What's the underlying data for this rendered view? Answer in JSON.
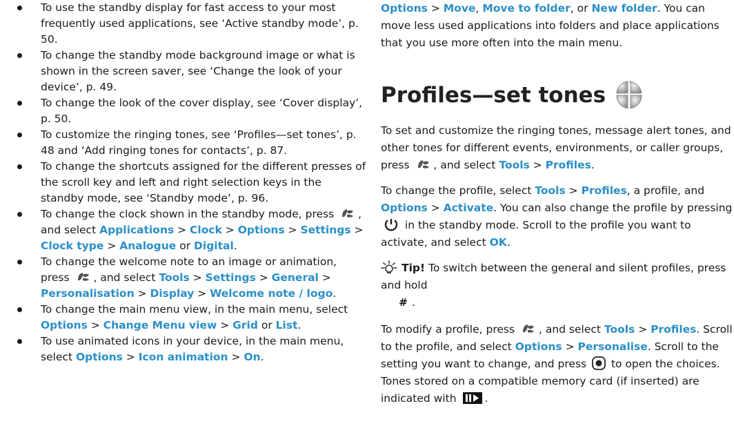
{
  "left": {
    "bullets": [
      {
        "parts": [
          {
            "t": "To use the standby display for fast access to your most frequently used applications, see ‘Active standby mode’, p. 50."
          }
        ]
      },
      {
        "parts": [
          {
            "t": "To change the standby mode background image or what is shown in the screen saver, see ‘Change the look of your device’, p. 49."
          }
        ]
      },
      {
        "parts": [
          {
            "t": "To change the look of the cover display, see ‘Cover display’, p. 50."
          }
        ]
      },
      {
        "parts": [
          {
            "t": "To customize the ringing tones, see ‘Profiles—set tones’, p. 48 and ‘Add ringing tones for contacts’, p. 87."
          }
        ]
      },
      {
        "parts": [
          {
            "t": "To change the shortcuts assigned for the different presses of the scroll key and left and right selection keys in the standby mode, see ‘Standby mode’, p. 96."
          }
        ]
      },
      {
        "parts": [
          {
            "t": "To change the clock shown in the standby mode, press "
          },
          {
            "icon": "menu-key-icon"
          },
          {
            "t": ", and select "
          },
          {
            "k": "Applications"
          },
          {
            "t": " > "
          },
          {
            "k": "Clock"
          },
          {
            "t": " > "
          },
          {
            "k": "Options"
          },
          {
            "t": " > "
          },
          {
            "k": "Settings"
          },
          {
            "t": " > "
          },
          {
            "k": "Clock type"
          },
          {
            "t": " > "
          },
          {
            "k": "Analogue"
          },
          {
            "t": " or "
          },
          {
            "k": "Digital"
          },
          {
            "t": "."
          }
        ]
      },
      {
        "parts": [
          {
            "t": "To change the welcome note to an image or animation, press "
          },
          {
            "icon": "menu-key-icon"
          },
          {
            "t": ", and select "
          },
          {
            "k": "Tools"
          },
          {
            "t": " > "
          },
          {
            "k": "Settings"
          },
          {
            "t": " > "
          },
          {
            "k": "General"
          },
          {
            "t": " > "
          },
          {
            "k": "Personalisation"
          },
          {
            "t": " > "
          },
          {
            "k": "Display"
          },
          {
            "t": " > "
          },
          {
            "k": "Welcome note / logo"
          },
          {
            "t": "."
          }
        ]
      },
      {
        "parts": [
          {
            "t": "To change the main menu view, in the main menu, select "
          },
          {
            "k": "Options"
          },
          {
            "t": " > "
          },
          {
            "k": "Change Menu view"
          },
          {
            "t": " > "
          },
          {
            "k": "Grid"
          },
          {
            "t": " or "
          },
          {
            "k": "List"
          },
          {
            "t": "."
          }
        ]
      },
      {
        "parts": [
          {
            "t": "To use animated icons in your device, in the main menu, select "
          },
          {
            "k": "Options"
          },
          {
            "t": " > "
          },
          {
            "k": "Icon animation"
          },
          {
            "t": " > "
          },
          {
            "k": "On"
          },
          {
            "t": "."
          }
        ]
      }
    ]
  },
  "right": {
    "intro": [
      {
        "k": "Options"
      },
      {
        "t": " > "
      },
      {
        "k": "Move"
      },
      {
        "t": ", "
      },
      {
        "k": "Move to folder"
      },
      {
        "t": ", or "
      },
      {
        "k": "New folder"
      },
      {
        "t": ". You can move less used applications into folders and place applications that you use more often into the main menu."
      }
    ],
    "heading": "Profiles—set tones",
    "paragraphs": [
      [
        {
          "t": "To set and customize the ringing tones, message alert tones, and other tones for different events, environments, or caller groups, press "
        },
        {
          "icon": "menu-key-icon"
        },
        {
          "t": ", and select "
        },
        {
          "k": "Tools"
        },
        {
          "t": " > "
        },
        {
          "k": "Profiles"
        },
        {
          "t": "."
        }
      ],
      [
        {
          "t": "To change the profile, select "
        },
        {
          "k": "Tools"
        },
        {
          "t": " > "
        },
        {
          "k": "Profiles"
        },
        {
          "t": ", a profile, and "
        },
        {
          "k": "Options"
        },
        {
          "t": " > "
        },
        {
          "k": "Activate"
        },
        {
          "t": ". You can also change the profile by pressing "
        },
        {
          "icon": "power-key-icon"
        },
        {
          "t": " in the standby mode. Scroll to the profile you want to activate, and select "
        },
        {
          "k": "OK"
        },
        {
          "t": "."
        }
      ]
    ],
    "tip": {
      "label": "Tip!",
      "text_before": " To switch between the general and silent profiles, press and hold ",
      "key": "#",
      "text_after": "."
    },
    "last_paragraph": [
      {
        "t": "To modify a profile, press "
      },
      {
        "icon": "menu-key-icon"
      },
      {
        "t": ", and select "
      },
      {
        "k": "Tools"
      },
      {
        "t": " > "
      },
      {
        "k": "Profiles"
      },
      {
        "t": ". Scroll to the profile, and select "
      },
      {
        "k": "Options"
      },
      {
        "t": " > "
      },
      {
        "k": "Personalise"
      },
      {
        "t": ". Scroll to the setting you want to change, and press "
      },
      {
        "icon": "scroll-key-icon"
      },
      {
        "t": " to open the choices. Tones stored on a compatible memory card (if inserted) are indicated with "
      },
      {
        "icon": "memory-card-icon"
      },
      {
        "t": "."
      }
    ]
  },
  "colors": {
    "keyword": "#2a8fc7",
    "text": "#1a1a1a"
  }
}
